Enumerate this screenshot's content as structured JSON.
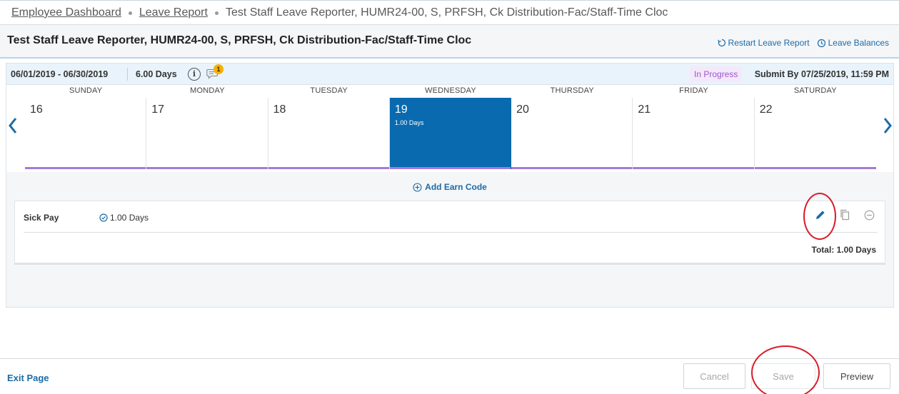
{
  "breadcrumb": {
    "items": [
      "Employee Dashboard",
      "Leave Report"
    ],
    "current": "Test Staff Leave Reporter, HUMR24-00, S, PRFSH, Ck Distribution-Fac/Staff-Time Cloc"
  },
  "header": {
    "title": "Test Staff Leave Reporter, HUMR24-00, S, PRFSH, Ck Distribution-Fac/Staff-Time Cloc",
    "restart_label": "Restart Leave Report",
    "balances_label": "Leave Balances"
  },
  "period": {
    "range": "06/01/2019 - 06/30/2019",
    "total": "6.00 Days",
    "comment_count": "1",
    "status": "In Progress",
    "submit_by": "Submit By 07/25/2019, 11:59 PM"
  },
  "week": {
    "days": [
      {
        "header": "SUNDAY",
        "date": "16",
        "hours": ""
      },
      {
        "header": "MONDAY",
        "date": "17",
        "hours": ""
      },
      {
        "header": "TUESDAY",
        "date": "18",
        "hours": ""
      },
      {
        "header": "WEDNESDAY",
        "date": "19",
        "hours": "1.00 Days"
      },
      {
        "header": "THURSDAY",
        "date": "20",
        "hours": ""
      },
      {
        "header": "FRIDAY",
        "date": "21",
        "hours": ""
      },
      {
        "header": "SATURDAY",
        "date": "22",
        "hours": ""
      }
    ]
  },
  "earn": {
    "add_label": "Add Earn Code",
    "entries": [
      {
        "name": "Sick Pay",
        "amount": "1.00 Days"
      }
    ],
    "total": "Total: 1.00 Days"
  },
  "footer": {
    "exit_label": "Exit Page",
    "cancel_label": "Cancel",
    "save_label": "Save",
    "preview_label": "Preview"
  },
  "colors": {
    "accent": "#1c6ba6",
    "selected_day": "#0a6ab0",
    "day_bar": "#a47ad6",
    "status_text": "#9b59c9",
    "annotation": "#d81e2a",
    "badge": "#f5b100"
  }
}
